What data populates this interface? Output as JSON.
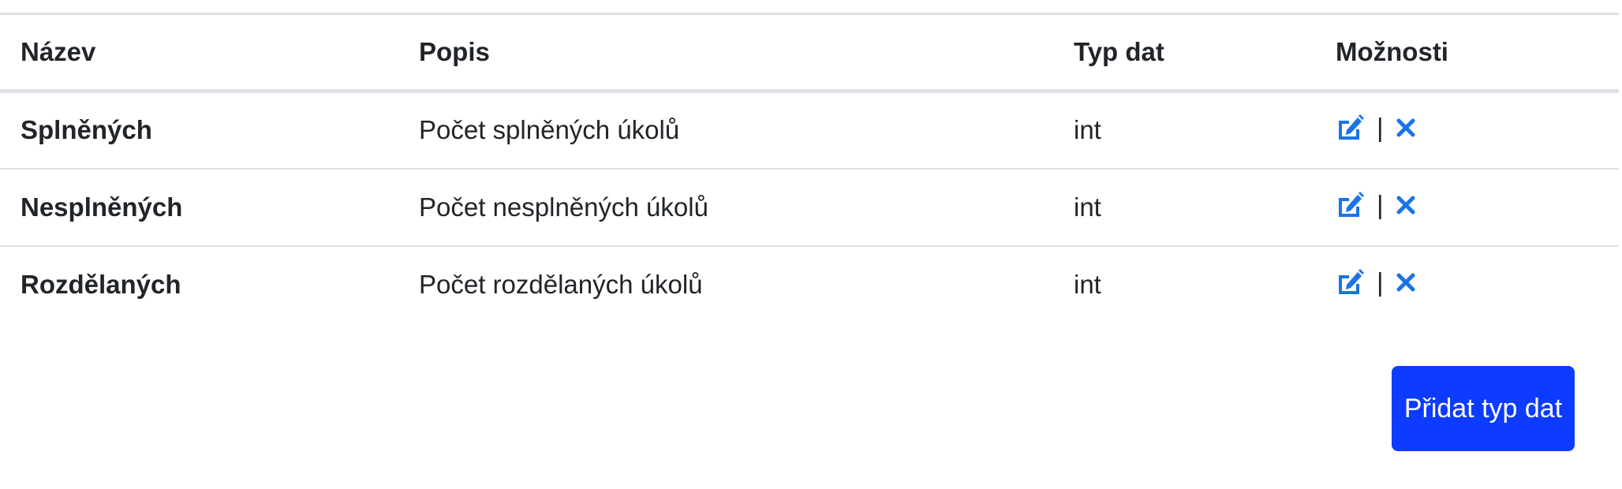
{
  "table": {
    "headers": [
      "Název",
      "Popis",
      "Typ dat",
      "Možnosti"
    ],
    "rows": [
      {
        "name": "Splněných",
        "description": "Počet splněných úkolů",
        "type": "int",
        "actions": [
          "edit-icon",
          "delete-icon"
        ]
      },
      {
        "name": "Nesplněných",
        "description": "Počet nesplněných úkolů",
        "type": "int",
        "actions": [
          "edit-icon",
          "delete-icon"
        ]
      },
      {
        "name": "Rozdělaných",
        "description": "Počet rozdělaných úkolů",
        "type": "int",
        "actions": [
          "edit-icon",
          "delete-icon"
        ]
      }
    ],
    "action_separator": "|"
  },
  "add_button_label": "Přidat typ dat",
  "colors": {
    "accent": "#1a73e8",
    "button_bg": "#0d3bff",
    "border": "#dee2e6",
    "text": "#212529"
  }
}
